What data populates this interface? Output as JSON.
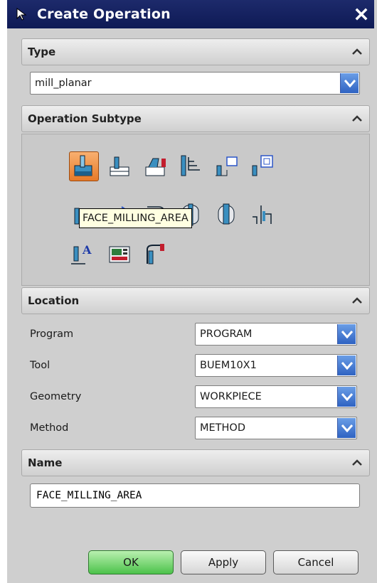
{
  "window": {
    "title": "Create Operation"
  },
  "type_section": {
    "label": "Type",
    "selected": "mill_planar"
  },
  "subtype_section": {
    "label": "Operation Subtype",
    "tooltip": "FACE_MILLING_AREA"
  },
  "location_section": {
    "label": "Location",
    "rows": [
      {
        "label": "Program",
        "value": "PROGRAM"
      },
      {
        "label": "Tool",
        "value": "BUEM10X1"
      },
      {
        "label": "Geometry",
        "value": "WORKPIECE"
      },
      {
        "label": "Method",
        "value": "METHOD"
      }
    ]
  },
  "name_section": {
    "label": "Name",
    "value": "FACE_MILLING_AREA"
  },
  "buttons": {
    "ok": "OK",
    "apply": "Apply",
    "cancel": "Cancel"
  }
}
